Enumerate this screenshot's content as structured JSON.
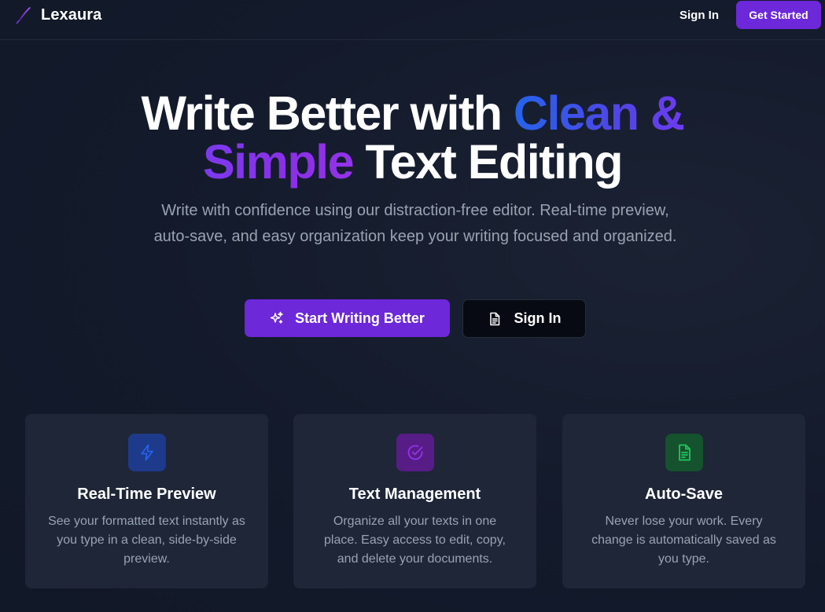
{
  "nav": {
    "brand": "Lexaura",
    "brand_icon": "feather-pen-icon",
    "signin_label": "Sign In",
    "cta_label": "Get Started"
  },
  "hero": {
    "title_part1": "Write Better with ",
    "title_highlight1": "Clean &",
    "title_highlight2": "Simple",
    "title_part2": " Text Editing",
    "subtitle": "Write with confidence using our distraction-free editor. Real-time preview, auto-save, and easy organization keep your writing focused and organized.",
    "primary_button": {
      "label": "Start Writing Better",
      "icon": "sparkles-icon"
    },
    "secondary_button": {
      "label": "Sign In",
      "icon": "document-icon"
    }
  },
  "features": [
    {
      "title": "Real-Time Preview",
      "text": "See your formatted text instantly as you type in a clean, side-by-side preview.",
      "icon": "lightning-icon",
      "icon_color": "#2563eb",
      "icon_bg": "#1e3a8a"
    },
    {
      "title": "Text Management",
      "text": "Organize all your texts in one place. Easy access to edit, copy, and delete your documents.",
      "icon": "check-circle-icon",
      "icon_color": "#9333ea",
      "icon_bg": "#581c87"
    },
    {
      "title": "Auto-Save",
      "text": "Never lose your work. Every change is automatically saved as you type.",
      "icon": "file-text-icon",
      "icon_color": "#22c55e",
      "icon_bg": "#14532d"
    }
  ],
  "colors": {
    "background": "#131a2b",
    "accent": "#6d28d9",
    "card": "#1e2637",
    "muted_text": "#9aa3b2"
  }
}
